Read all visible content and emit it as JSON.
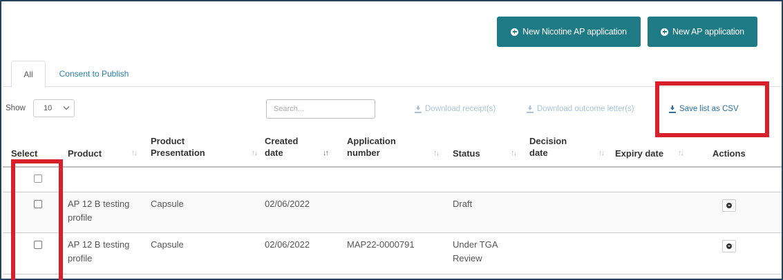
{
  "header": {
    "new_nicotine_btn": "New Nicotine AP application",
    "new_ap_btn": "New AP application"
  },
  "tabs": {
    "all": "All",
    "consent": "Consent to Publish"
  },
  "controls": {
    "show_label": "Show",
    "show_value": "10",
    "search_placeholder": "Search...",
    "download_receipts": "Download receipt(s)",
    "download_outcome": "Download outcome letter(s)",
    "save_csv": "Save list as CSV"
  },
  "table": {
    "columns": {
      "select": "Select",
      "product": "Product",
      "presentation_1": "Product",
      "presentation_2": "Presentation",
      "created_1": "Created",
      "created_2": "date",
      "appnum_1": "Application",
      "appnum_2": "number",
      "status": "Status",
      "decision_1": "Decision",
      "decision_2": "date",
      "expiry": "Expiry date",
      "actions": "Actions"
    },
    "rows": [
      {
        "product_1": "AP 12 B testing",
        "product_2": "profile",
        "presentation": "Capsule",
        "created": "02/06/2022",
        "app_number": "",
        "status_1": "Draft",
        "status_2": ""
      },
      {
        "product_1": "AP 12 B testing",
        "product_2": "profile",
        "presentation": "Capsule",
        "created": "02/06/2022",
        "app_number": "MAP22-0000791",
        "status_1": "Under TGA",
        "status_2": "Review"
      }
    ]
  },
  "colors": {
    "primary_button": "#1e7a84",
    "highlight": "#d81f2a",
    "link": "#2a7ea8"
  }
}
